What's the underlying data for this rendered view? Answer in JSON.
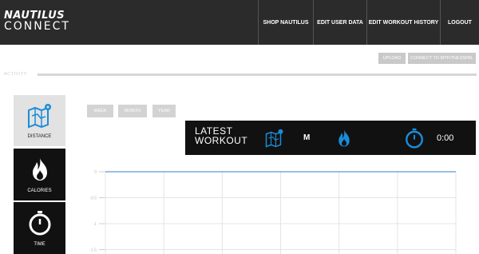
{
  "header": {
    "logo_line1": "NAUTILUS",
    "logo_line2": "CONNECT",
    "nav": [
      "SHOP NAUTILUS",
      "EDIT USER DATA",
      "EDIT WORKOUT HISTORY",
      "LOGOUT"
    ]
  },
  "actions": {
    "upload": "UPLOAD",
    "connect": "CONNECT TO MYFITNESSPAL"
  },
  "activity_label": "ACTIVITY",
  "sidebar": [
    {
      "label": "DISTANCE",
      "icon": "map-icon",
      "active": true
    },
    {
      "label": "CALORIES",
      "icon": "flame-icon",
      "active": false
    },
    {
      "label": "TIME",
      "icon": "stopwatch-icon",
      "active": false
    }
  ],
  "range_tabs": [
    "WEEK",
    "MONTH",
    "YEAR"
  ],
  "latest": {
    "title_line1": "LATEST",
    "title_line2": "WORKOUT",
    "distance_unit": "M",
    "time_value": "0:00"
  },
  "chart_data": {
    "type": "line",
    "yticks": [
      "0",
      "-0.5",
      "-1",
      "-1.5"
    ],
    "series": [
      {
        "values": [
          0,
          0,
          0,
          0,
          0,
          0,
          0
        ]
      }
    ],
    "grid": true,
    "line_color": "#5b9bd5"
  },
  "colors": {
    "accent": "#1a8cd8",
    "topbar": "#2b2b2b"
  }
}
